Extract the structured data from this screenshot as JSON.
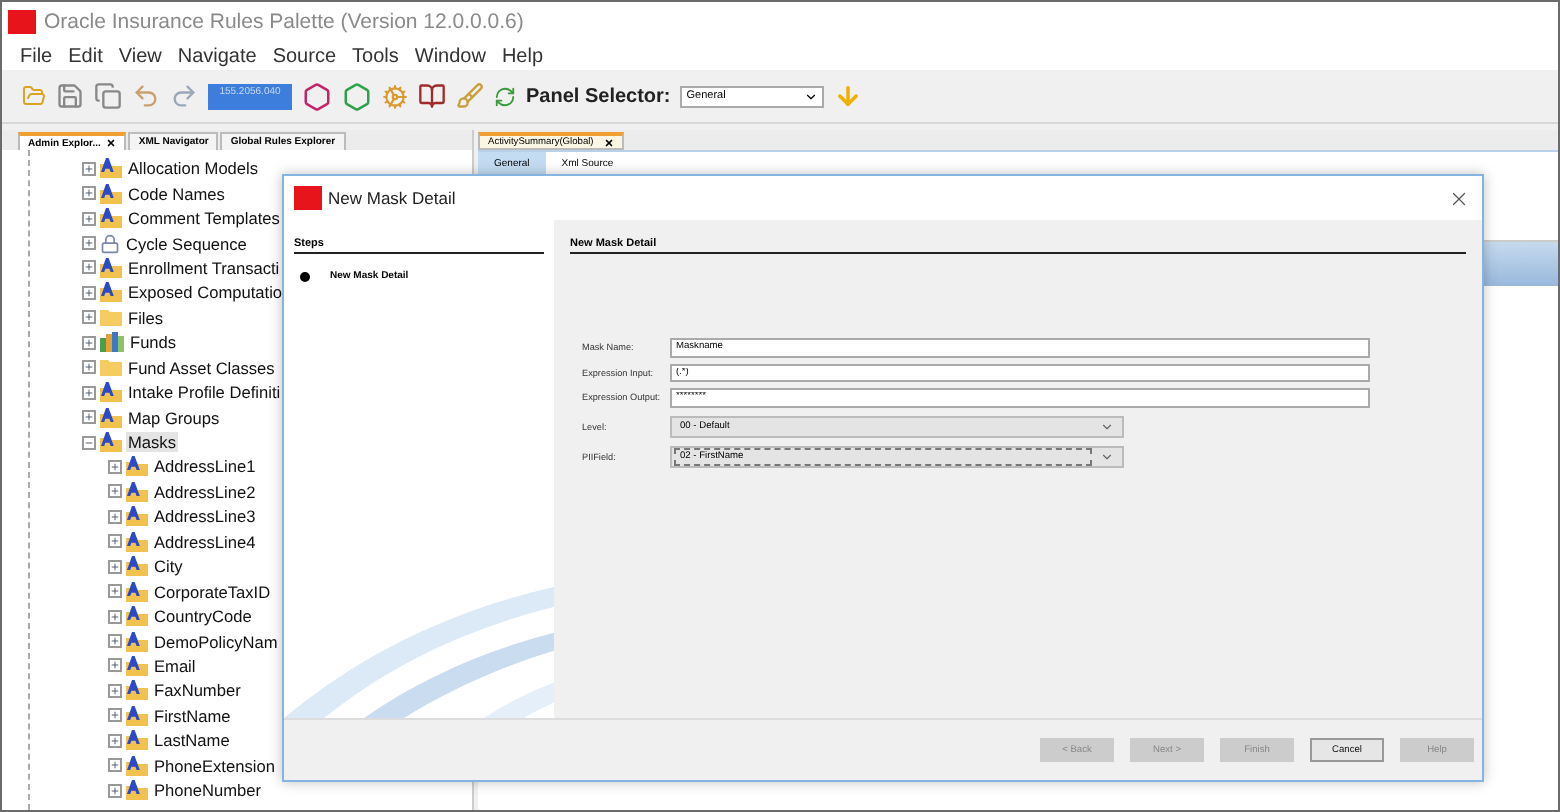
{
  "window": {
    "title": "Oracle Insurance Rules Palette (Version 12.0.0.0.6)"
  },
  "menu": [
    "File",
    "Edit",
    "View",
    "Navigate",
    "Source",
    "Tools",
    "Window",
    "Help"
  ],
  "toolbar": {
    "environment": "155.2056.040",
    "panel_selector": {
      "label": "Panel Selector:",
      "value": "General"
    }
  },
  "left_pane": {
    "tabs": [
      {
        "label": "Admin Explor...",
        "selected": true
      },
      {
        "label": "XML Navigator",
        "selected": false
      },
      {
        "label": "Global Rules Explorer",
        "selected": false
      }
    ],
    "tree": [
      {
        "label": "Allocation Models",
        "kind": "rule",
        "expanded": false,
        "selected": false
      },
      {
        "label": "Code Names",
        "kind": "rule",
        "expanded": false,
        "selected": false
      },
      {
        "label": "Comment Templates",
        "kind": "rule",
        "expanded": false,
        "selected": false
      },
      {
        "label": "Cycle Sequence",
        "kind": "locked",
        "expanded": false,
        "selected": false
      },
      {
        "label": "Enrollment Transacti",
        "kind": "rule",
        "expanded": false,
        "selected": false
      },
      {
        "label": "Exposed Computatio",
        "kind": "rule",
        "expanded": false,
        "selected": false
      },
      {
        "label": "Files",
        "kind": "folder",
        "expanded": false,
        "selected": false
      },
      {
        "label": "Funds",
        "kind": "funds",
        "expanded": false,
        "selected": false
      },
      {
        "label": "Fund Asset Classes",
        "kind": "folder",
        "expanded": false,
        "selected": false
      },
      {
        "label": "Intake Profile Definiti",
        "kind": "rule",
        "expanded": false,
        "selected": false
      },
      {
        "label": "Map Groups",
        "kind": "rule",
        "expanded": false,
        "selected": false
      },
      {
        "label": "Masks",
        "kind": "rule",
        "expanded": true,
        "selected": true,
        "children": [
          {
            "label": "AddressLine1",
            "kind": "rule",
            "expanded": false,
            "selected": false
          },
          {
            "label": "AddressLine2",
            "kind": "rule",
            "expanded": false,
            "selected": false
          },
          {
            "label": "AddressLine3",
            "kind": "rule",
            "expanded": false,
            "selected": false
          },
          {
            "label": "AddressLine4",
            "kind": "rule",
            "expanded": false,
            "selected": false
          },
          {
            "label": "City",
            "kind": "rule",
            "expanded": false,
            "selected": false
          },
          {
            "label": "CorporateTaxID",
            "kind": "rule",
            "expanded": false,
            "selected": false
          },
          {
            "label": "CountryCode",
            "kind": "rule",
            "expanded": false,
            "selected": false
          },
          {
            "label": "DemoPolicyNam",
            "kind": "rule",
            "expanded": false,
            "selected": false
          },
          {
            "label": "Email",
            "kind": "rule",
            "expanded": false,
            "selected": false
          },
          {
            "label": "FaxNumber",
            "kind": "rule",
            "expanded": false,
            "selected": false
          },
          {
            "label": "FirstName",
            "kind": "rule",
            "expanded": false,
            "selected": false
          },
          {
            "label": "LastName",
            "kind": "rule",
            "expanded": false,
            "selected": false
          },
          {
            "label": "PhoneExtension",
            "kind": "rule",
            "expanded": false,
            "selected": false
          },
          {
            "label": "PhoneNumber",
            "kind": "rule",
            "expanded": false,
            "selected": false
          }
        ]
      }
    ]
  },
  "editor": {
    "tabs": [
      {
        "label": "ActivitySummary(Global)",
        "selected": true
      }
    ],
    "subtabs": [
      {
        "label": "General",
        "selected": true
      },
      {
        "label": "Xml Source",
        "selected": false
      }
    ]
  },
  "dialog": {
    "title": "New Mask Detail",
    "steps_heading": "Steps",
    "steps": [
      {
        "label": "New Mask Detail",
        "selected": true
      }
    ],
    "page_heading": "New Mask Detail",
    "fields": [
      {
        "kind": "text",
        "label": "Mask Name:",
        "value": "Maskname"
      },
      {
        "kind": "text",
        "label": "Expression Input:",
        "value": "(.*)"
      },
      {
        "kind": "text",
        "label": "Expression Output:",
        "value": "********"
      },
      {
        "kind": "select",
        "label": "Level:",
        "value": "00 - Default",
        "focused": false
      },
      {
        "kind": "select",
        "label": "PIIField:",
        "value": "02 - FirstName",
        "focused": true
      }
    ],
    "buttons": [
      {
        "label": "< Back",
        "disabled": true
      },
      {
        "label": "Next >",
        "disabled": true
      },
      {
        "label": "Finish",
        "disabled": true
      },
      {
        "label": "Cancel",
        "disabled": false
      },
      {
        "label": "Help",
        "disabled": true
      }
    ]
  }
}
